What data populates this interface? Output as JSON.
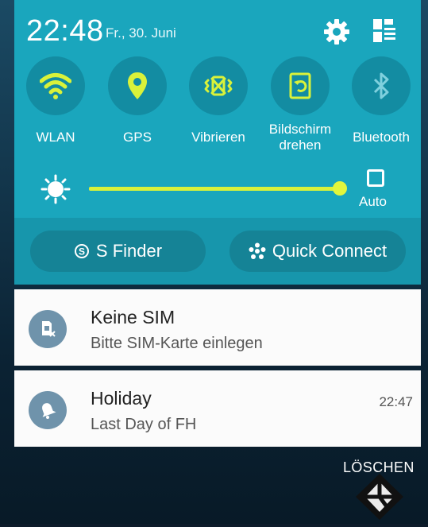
{
  "status": {
    "time": "22:48",
    "date": "Fr., 30. Juni"
  },
  "icons": {
    "settings": "gear-icon",
    "edit": "grid-edit-icon"
  },
  "quick_toggles": [
    {
      "label": "WLAN",
      "icon": "wifi-icon",
      "active": true
    },
    {
      "label": "GPS",
      "icon": "location-icon",
      "active": true
    },
    {
      "label": "Vibrieren",
      "icon": "vibrate-icon",
      "active": true
    },
    {
      "label": "Bildschirm\ndrehen",
      "icon": "screen-rotation-icon",
      "active": true
    },
    {
      "label": "Bluetooth",
      "icon": "bluetooth-icon",
      "active": false
    }
  ],
  "brightness": {
    "level": 0.95,
    "auto_label": "Auto",
    "auto_checked": false
  },
  "actions": {
    "s_finder": "S Finder",
    "quick_connect": "Quick Connect"
  },
  "notifications": [
    {
      "title": "Keine SIM",
      "subtitle": "Bitte SIM-Karte einlegen",
      "time": ""
    },
    {
      "title": "Holiday",
      "subtitle": "Last Day of FH",
      "time": "22:47"
    }
  ],
  "clear_label": "LÖSCHEN",
  "colors": {
    "panel": "#1aa6bd",
    "accent": "#d9f23a",
    "active_icon": "#d9f23a",
    "inactive_icon": "#7fd0de"
  }
}
